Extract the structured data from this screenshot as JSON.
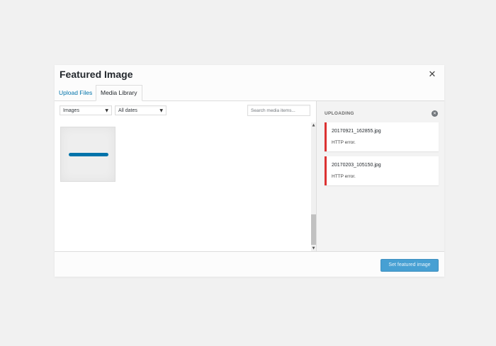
{
  "modal": {
    "title": "Featured Image",
    "close_icon": "close-icon"
  },
  "tabs": [
    {
      "label": "Upload Files",
      "active": false
    },
    {
      "label": "Media Library",
      "active": true
    }
  ],
  "toolbar": {
    "type_filter": "Images",
    "date_filter": "All dates",
    "search_placeholder": "Search media items..."
  },
  "attachments": [
    {
      "state": "uploading"
    }
  ],
  "uploads": {
    "title": "UPLOADING",
    "dismiss_icon": "dismiss-circle-icon",
    "errors": [
      {
        "filename": "20170921_162855.jpg",
        "message": "HTTP error."
      },
      {
        "filename": "20170203_105150.jpg",
        "message": "HTTP error."
      }
    ]
  },
  "footer": {
    "button_label": "Set featured image"
  },
  "colors": {
    "accent": "#0073aa",
    "error": "#dc3232",
    "button": "#47a0d3"
  }
}
